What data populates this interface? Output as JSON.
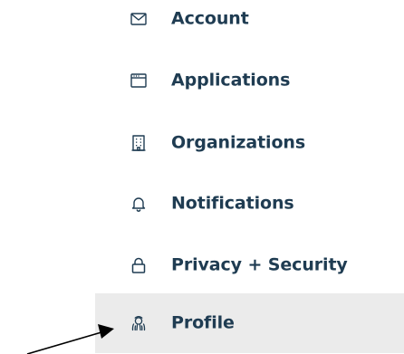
{
  "menu": {
    "items": [
      {
        "label": "Account",
        "icon": "mail-icon",
        "active": false
      },
      {
        "label": "Applications",
        "icon": "app-window-icon",
        "active": false
      },
      {
        "label": "Organizations",
        "icon": "building-icon",
        "active": false
      },
      {
        "label": "Notifications",
        "icon": "bell-icon",
        "active": false
      },
      {
        "label": "Privacy + Security",
        "icon": "lock-icon",
        "active": false
      },
      {
        "label": "Profile",
        "icon": "profile-icon",
        "active": true
      }
    ]
  },
  "colors": {
    "label_text": "#1f3c52",
    "icon_stroke": "#1f3c52",
    "active_background": "#ebebeb",
    "arrow": "#000000"
  }
}
